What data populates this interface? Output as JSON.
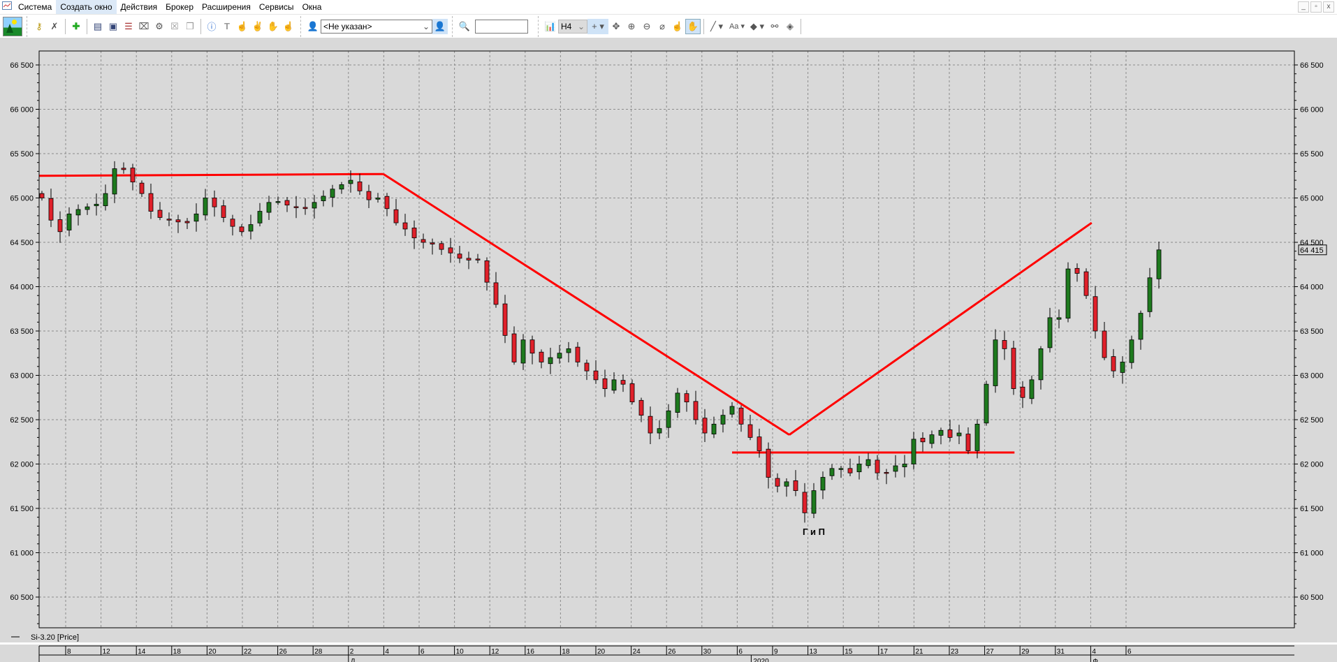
{
  "menu": {
    "items": [
      "Система",
      "Создать окно",
      "Действия",
      "Брокер",
      "Расширения",
      "Сервисы",
      "Окна"
    ],
    "active": 1
  },
  "window_controls": [
    "minimize-icon",
    "restore-icon",
    "close-icon"
  ],
  "toolbar": {
    "left_icons": [
      "key-icon",
      "disconnect-icon",
      "new-window-icon",
      "chart-window-icon",
      "quote-window-icon",
      "orders-icon",
      "portfolio-icon",
      "settings-icon",
      "delete-icon",
      "copy-icon",
      "alert-icon",
      "text-icon",
      "hand1-icon",
      "hand2-icon",
      "hand3-icon",
      "hand4-icon"
    ],
    "account_select": "<Не указан>",
    "search_value": "",
    "timeframe": "H4",
    "right_icons": [
      "crosshair-icon",
      "move-icon",
      "zoom-in-icon",
      "zoom-out-icon",
      "ruler-icon",
      "pointer-icon",
      "hand-icon",
      "line-icon",
      "text-tool-icon",
      "fill-icon",
      "link-icon",
      "layers-icon"
    ],
    "text_tool_label": "Aa"
  },
  "legend": "Si-3.20 [Price]",
  "chart_data": {
    "type": "candlestick",
    "instrument": "Si-3.20",
    "timeframe": "H4",
    "last_price_label": "64 415",
    "y_ticks": [
      "66 500",
      "66 000",
      "65 500",
      "65 000",
      "64 500",
      "64 000",
      "63 500",
      "63 000",
      "62 500",
      "62 000",
      "61 500",
      "61 000",
      "60 500"
    ],
    "y_tick_values": [
      66500,
      66000,
      65500,
      65000,
      64500,
      64000,
      63500,
      63000,
      62500,
      62000,
      61500,
      61000,
      60500
    ],
    "ylim": [
      60400,
      66700
    ],
    "x_ticks": [
      "8",
      "12",
      "14",
      "18",
      "20",
      "22",
      "26",
      "28",
      "2",
      "4",
      "6",
      "10",
      "12",
      "16",
      "18",
      "20",
      "24",
      "26",
      "30",
      "6",
      "9",
      "13",
      "15",
      "17",
      "21",
      "23",
      "27",
      "29",
      "31",
      "4",
      "6"
    ],
    "month_labels": [
      {
        "label": "Д",
        "at_tick": 8
      },
      {
        "label": "2020",
        "at_tick": 19
      },
      {
        "label": "Ф",
        "at_tick": 29
      }
    ],
    "grid": true,
    "colors": {
      "up": "#1e7a1e",
      "down": "#e0202a",
      "line": "#ff0000",
      "grid": "#8c8c8c",
      "background": "#d9d9d9"
    },
    "closes": [
      65000,
      64750,
      64620,
      64820,
      64870,
      64900,
      64930,
      65050,
      65330,
      65320,
      65180,
      65050,
      64850,
      64780,
      64760,
      64730,
      64720,
      64820,
      65000,
      64900,
      64780,
      64680,
      64620,
      64700,
      64850,
      64950,
      64960,
      64920,
      64900,
      64880,
      64950,
      65020,
      65100,
      65150,
      65200,
      65080,
      64980,
      65000,
      64880,
      64720,
      64650,
      64550,
      64500,
      64480,
      64420,
      64380,
      64320,
      64300,
      64310,
      64050,
      63800,
      63450,
      63150,
      63400,
      63250,
      63150,
      63200,
      63250,
      63300,
      63150,
      63050,
      62950,
      62850,
      62950,
      62900,
      62700,
      62550,
      62350,
      62400,
      62600,
      62800,
      62700,
      62500,
      62350,
      62450,
      62550,
      62650,
      62450,
      62300,
      62150,
      61850,
      61750,
      61800,
      61700,
      61450,
      61700,
      61850,
      61950,
      61950,
      61900,
      62000,
      62050,
      61900,
      61900,
      61980,
      62000,
      62280,
      62250,
      62330,
      62380,
      62300,
      62350,
      62150,
      62450,
      62900,
      63400,
      63300,
      62850,
      62750,
      62950,
      63300,
      63650,
      63650,
      64200,
      64150,
      63900,
      63500,
      63200,
      63050,
      63150,
      63400,
      63700,
      64100,
      64415
    ],
    "trend_lines": [
      {
        "from": [
          -0.5,
          65250
        ],
        "to": [
          37.6,
          65270
        ]
      },
      {
        "from": [
          37.6,
          65270
        ],
        "to": [
          82.3,
          62330
        ]
      },
      {
        "from": [
          82.3,
          62330
        ],
        "to": [
          115.6,
          64720
        ]
      },
      {
        "from": [
          76,
          62130
        ],
        "to": [
          107.1,
          62130
        ]
      }
    ],
    "annotations": [
      {
        "text": "Г и П",
        "bar": 85,
        "price": 61200
      }
    ]
  }
}
